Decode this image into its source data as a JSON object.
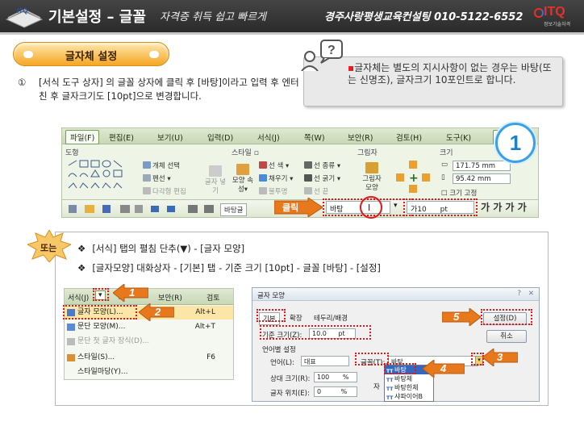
{
  "header": {
    "title": "기본설정 – 글꼴",
    "slogan": "자격증 취득 쉽고 빠르게",
    "org": "경주사랑평생교육컨설팅  010-5122-6552",
    "logo_text": "ITQ",
    "logo_sub": "정보기술자격",
    "corner_logo_text": "ITQ"
  },
  "section": {
    "pill_label": "글자체 설정"
  },
  "tip": {
    "bullet": "▪",
    "text": "글자체는 별도의 지시사항이 없는 경우는 바탕(또는 신명조), 글자크기 10포인트로 합니다."
  },
  "step1": {
    "number": "①",
    "text": "[서식 도구 상자] 의 글꼴 상자에 클릭 후 [바탕]이라고 입력 후 엔터친 후 글자크기도 [10pt]으로 변경합니다."
  },
  "toolbar": {
    "menus": [
      "파일(F)",
      "편집(E)",
      "보기(U)",
      "입력(D)",
      "서식(J)",
      "쪽(W)",
      "보안(R)",
      "검토(H)",
      "도구(K)"
    ],
    "menu_extra": "도",
    "groups": [
      "도형",
      "스타일 ▫",
      "그림자",
      "크기"
    ],
    "items": {
      "object_select": "개체 선택",
      "pen": "펜선",
      "multi_edit": "다각형 편집",
      "text_box": "글자 넣기",
      "shape_prop": "모양 속성",
      "line_color": "선 색",
      "fill": "채우기",
      "transparency": "불투명",
      "line_kind": "선 종류",
      "line_width": "선 굵기",
      "line_end": "선 끝",
      "shadow_effect": "그림자 모양",
      "fix_size": "크기 고정"
    },
    "width_value": "171.75",
    "height_value": "95.42",
    "unit": "mm",
    "font_value": "바탕",
    "size_value": "10",
    "size_unit": "pt",
    "size_prefix": "가",
    "click_label": "클릭",
    "format_glyphs": [
      "가",
      "가",
      "가",
      "가"
    ],
    "step_badge": "1"
  },
  "alt": {
    "badge_label": "또는",
    "line1": "[서식] 탭의 펼침 단추(▼) - [글자 모양]",
    "line2": "[글자모양] 대화상자 - [기본] 탭 - 기준 크기 [10pt] - 글꼴 [바탕] - [설정]",
    "diamond": "❖"
  },
  "menu_crop": {
    "bar": [
      "서식(J)",
      "▾",
      "쪽",
      "보안(R)",
      "검토"
    ],
    "items": [
      {
        "label": "글자 모양(L)...",
        "shortcut": "Alt+L"
      },
      {
        "label": "문단 모양(M)...",
        "shortcut": "Alt+T"
      },
      {
        "label": "문단 첫 글자 장식(D)...",
        "shortcut": ""
      },
      {
        "label": "스타일(S)...",
        "shortcut": "F6"
      },
      {
        "label": "스타일마당(Y)...",
        "shortcut": ""
      }
    ],
    "arrow1": "1",
    "arrow2": "2"
  },
  "dialog": {
    "title": "글자 모양",
    "help": "?",
    "close": "✕",
    "tabs": [
      "기본",
      "확장",
      "테두리/배경"
    ],
    "base_size_label": "기준 크기(Z):",
    "base_size_value": "10.0",
    "base_size_unit": "pt",
    "lang_group": "언어별 설정",
    "lang_label": "언어(L):",
    "lang_value": "대표",
    "font_label": "글꼴(T):",
    "font_value": "바탕",
    "ratio_label": "상대 크기(R):",
    "ratio_value": "100",
    "ratio_unit": "%",
    "pos_label": "글자 위치(E):",
    "pos_value": "0",
    "pos_unit": "%",
    "jang_label": "자",
    "set_button": "설정(D)",
    "cancel_button": "취소",
    "dropdown": [
      {
        "tag": "TT",
        "name": "바탕"
      },
      {
        "tag": "TT",
        "name": "바탕체"
      },
      {
        "tag": "TT",
        "name": "바탕한체"
      },
      {
        "tag": "TT",
        "name": "샤파이어B"
      }
    ],
    "arrow3": "3",
    "arrow4": "4",
    "arrow5": "5"
  },
  "colors": {
    "header_bg": "#333333",
    "accent_orange": "#f5a623",
    "arrow_orange": "#e8781c",
    "highlight_red": "#e01818",
    "badge_blue": "#1c7fc8"
  }
}
